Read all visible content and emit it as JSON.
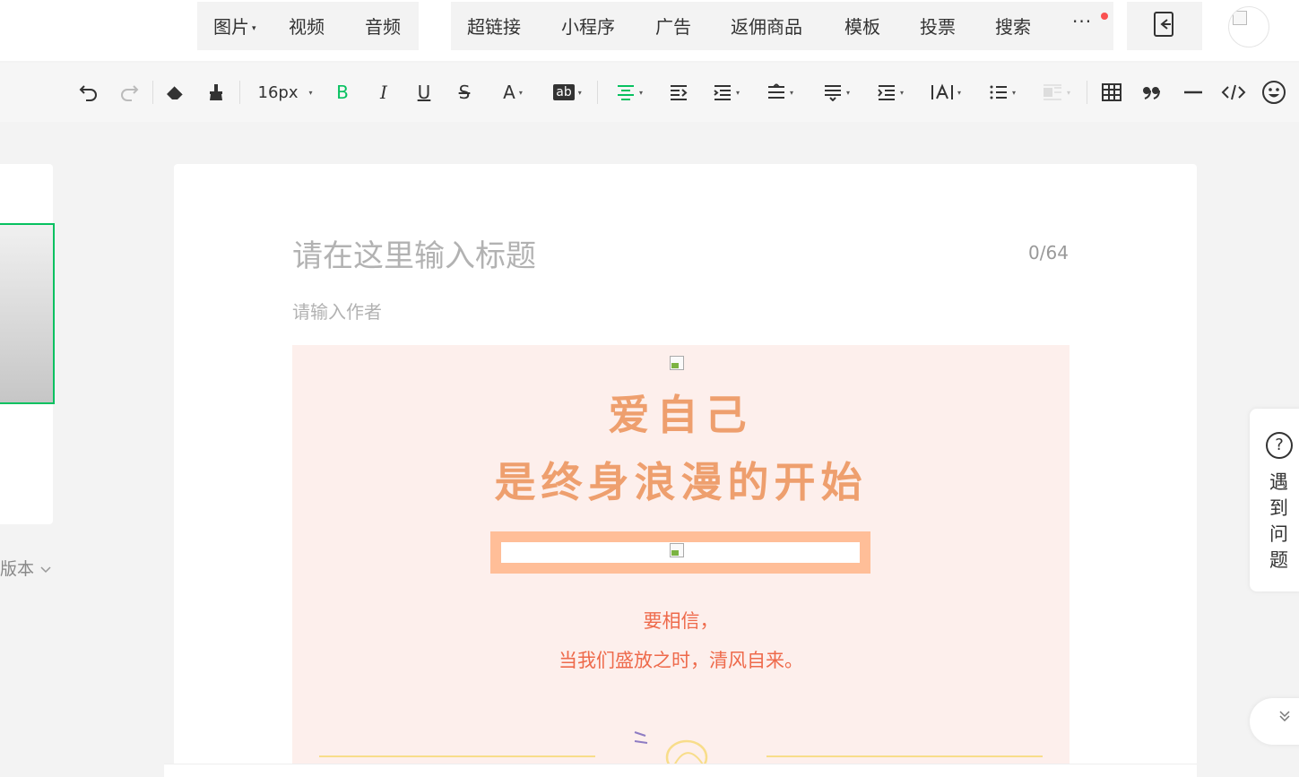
{
  "insert_bar": {
    "group1": [
      {
        "label": "图片",
        "dropdown": true
      },
      {
        "label": "视频"
      },
      {
        "label": "音频"
      }
    ],
    "group2": [
      {
        "label": "超链接"
      },
      {
        "label": "小程序"
      },
      {
        "label": "广告"
      },
      {
        "label": "返佣商品"
      },
      {
        "label": "模板"
      },
      {
        "label": "投票"
      },
      {
        "label": "搜索"
      }
    ],
    "more_label": "···",
    "dropdown_caret": "▾"
  },
  "format_bar": {
    "font_size": "16px",
    "bold": "B",
    "italic": "I",
    "underline": "U",
    "strikethrough": "S",
    "font_color": "A",
    "highlight": "ab",
    "accent_color": "#07c160"
  },
  "editor": {
    "title_placeholder": "请在这里输入标题",
    "title_count": "0/64",
    "author_placeholder": "请输入作者"
  },
  "article": {
    "heading_line1": "爱自己",
    "heading_line2": "是终身浪漫的开始",
    "para_line1": "要相信，",
    "para_line2": "当我们盛放之时，清风自来。",
    "heading_color": "#ee9f6e",
    "text_color": "#ee6a4b",
    "background": "#fdefec"
  },
  "left_panel": {
    "version_label": "版本"
  },
  "help": {
    "icon_text": "?",
    "label": "遇到问题"
  }
}
